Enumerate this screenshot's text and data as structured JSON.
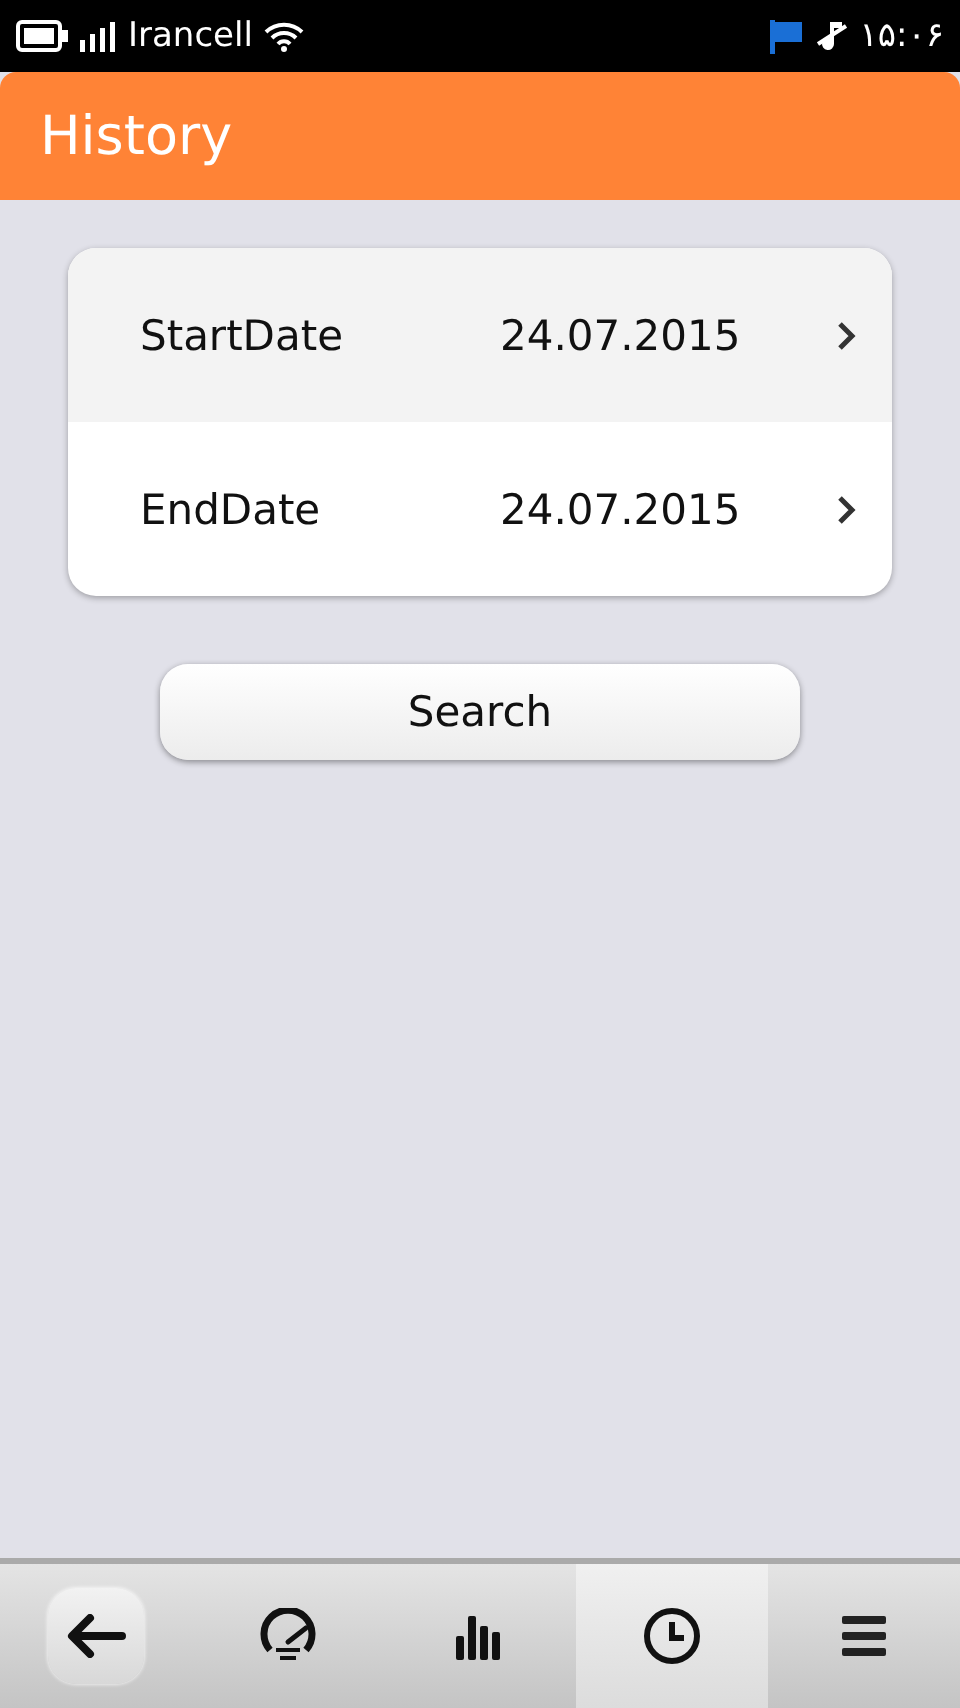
{
  "status_bar": {
    "carrier": "Irancell",
    "time": "۱۵:۰۶"
  },
  "header": {
    "title": "History"
  },
  "date_rows": [
    {
      "label": "StartDate",
      "value": "24.07.2015",
      "selected": true
    },
    {
      "label": "EndDate",
      "value": "24.07.2015",
      "selected": false
    }
  ],
  "search_button": {
    "label": "Search"
  },
  "toolbar": [
    {
      "kind": "back",
      "selected": false
    },
    {
      "kind": "speedometer",
      "selected": false
    },
    {
      "kind": "chart",
      "selected": false
    },
    {
      "kind": "clock",
      "selected": true
    },
    {
      "kind": "menu",
      "selected": false
    }
  ]
}
